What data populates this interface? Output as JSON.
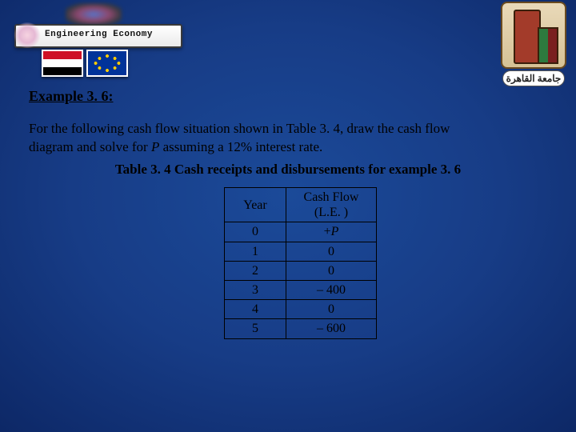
{
  "logos": {
    "vision_label": "Engineering Economy",
    "crest_caption_ar": "جامعة القاهرة"
  },
  "heading": "Example 3. 6:",
  "paragraph": {
    "line1": "For the following cash flow situation shown in Table 3. 4, draw the cash flow",
    "line2_a": "diagram and solve for ",
    "line2_P": "P",
    "line2_b": " assuming a 12% interest rate."
  },
  "table_caption": "Table 3. 4 Cash receipts and disbursements for example 3. 6",
  "table": {
    "headers": {
      "year": "Year",
      "cash_flow_l1": "Cash Flow",
      "cash_flow_l2": "(L.E. )"
    },
    "rows": [
      {
        "year": "0",
        "cf_prefix": "+",
        "cf_P": "P"
      },
      {
        "year": "1",
        "cf": "0"
      },
      {
        "year": "2",
        "cf": "0"
      },
      {
        "year": "3",
        "cf": "– 400"
      },
      {
        "year": "4",
        "cf": "0"
      },
      {
        "year": "5",
        "cf": "– 600"
      }
    ]
  },
  "chart_data": {
    "type": "table",
    "title": "Table 3.4 Cash receipts and disbursements for example 3.6",
    "columns": [
      "Year",
      "Cash Flow (L.E.)"
    ],
    "rows": [
      [
        "0",
        "+P"
      ],
      [
        "1",
        "0"
      ],
      [
        "2",
        "0"
      ],
      [
        "3",
        "-400"
      ],
      [
        "4",
        "0"
      ],
      [
        "5",
        "-600"
      ]
    ],
    "interest_rate_pct": 12,
    "unknown": "P"
  }
}
